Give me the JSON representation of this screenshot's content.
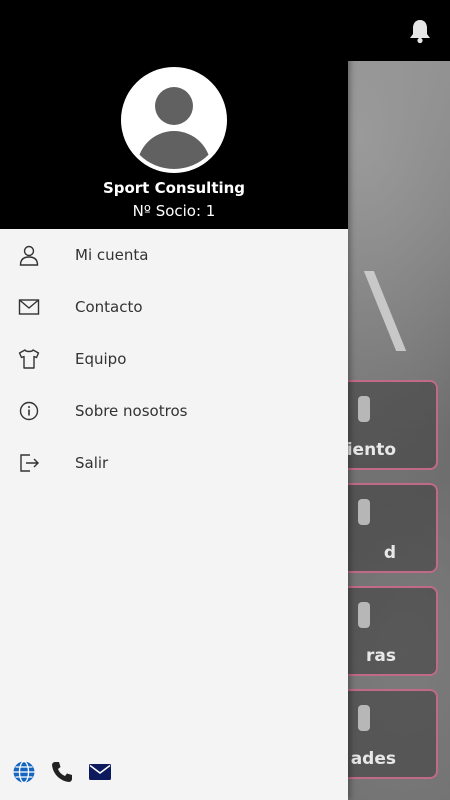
{
  "colors": {
    "drawer_bg": "#f4f4f4",
    "header_bg": "#000000",
    "card_border": "#c06a86",
    "footer_icon_blue": "#1565c0",
    "footer_icon_navy": "#0d1b5e"
  },
  "profile": {
    "avatar_icon": "user-avatar-icon",
    "name": "Sport Consulting",
    "member_number": "Nº Socio: 1"
  },
  "menu": [
    {
      "icon": "user-icon",
      "label": "Mi cuenta"
    },
    {
      "icon": "mail-icon",
      "label": "Contacto"
    },
    {
      "icon": "tshirt-icon",
      "label": "Equipo"
    },
    {
      "icon": "info-icon",
      "label": "Sobre nosotros"
    },
    {
      "icon": "logout-icon",
      "label": "Salir"
    }
  ],
  "background": {
    "cards": [
      {
        "label": "miento"
      },
      {
        "label": "d"
      },
      {
        "label": "ras"
      },
      {
        "label": "ades"
      }
    ]
  },
  "footer": {
    "icons": [
      "globe-icon",
      "phone-icon",
      "envelope-icon"
    ]
  },
  "topbar": {
    "icon": "bell-icon"
  }
}
